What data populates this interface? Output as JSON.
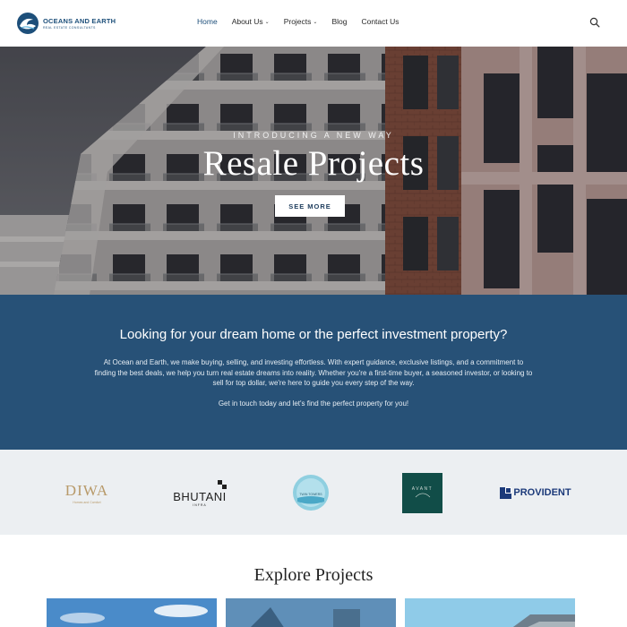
{
  "brand": {
    "name": "OCEANS AND EARTH",
    "tagline": "REAL ESTATE CONSULTANTS",
    "primary_color": "#275177",
    "accent_color": "#1a73d9"
  },
  "nav": {
    "items": [
      {
        "label": "Home",
        "active": true,
        "dropdown": false
      },
      {
        "label": "About Us",
        "active": false,
        "dropdown": true
      },
      {
        "label": "Projects",
        "active": false,
        "dropdown": true
      },
      {
        "label": "Blog",
        "active": false,
        "dropdown": false
      },
      {
        "label": "Contact Us",
        "active": false,
        "dropdown": false
      }
    ],
    "search_icon": "search-icon"
  },
  "hero": {
    "eyebrow": "INTRODUCING A NEW WAY",
    "title": "Resale Projects",
    "button_label": "SEE MORE"
  },
  "chat": {
    "icon": "chat-icon"
  },
  "intro": {
    "heading": "Looking for your dream home or the perfect investment property?",
    "body": "At Ocean and Earth, we make buying, selling, and investing effortless. With expert guidance, exclusive listings, and a commitment to finding the best deals, we help you turn real estate dreams into reality. Whether you're a first-time buyer, a seasoned investor, or looking to sell for top dollar, we're here to guide you every step of the way.",
    "cta": "Get in touch today and let's find the perfect property for you!"
  },
  "partners": [
    {
      "name": "DIWA",
      "sub": "Homes and Comfort"
    },
    {
      "name": "BHUTANI",
      "sub": "INFRA"
    },
    {
      "name": "TWIN TOWERS",
      "sub": ""
    },
    {
      "name": "AVANT",
      "sub": ""
    },
    {
      "name": "PROVIDENT",
      "sub": ""
    }
  ],
  "explore": {
    "title": "Explore Projects"
  }
}
